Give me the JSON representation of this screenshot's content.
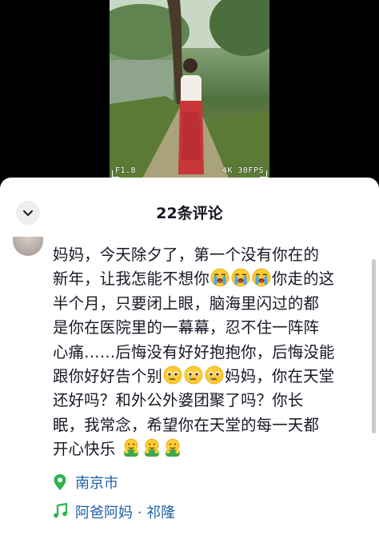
{
  "video": {
    "aperture": "F1.8",
    "quality": "4K 30FPS"
  },
  "comments_sheet": {
    "title": "22条评论"
  },
  "comment": {
    "lines": [
      {
        "text": "妈妈，今天除夕了，第一个没有你在的"
      },
      {
        "pre": "新年，让我怎能不想你",
        "emoji": "loudly-crying-face",
        "count": 3,
        "post": "你走的这"
      },
      {
        "text": "半个月，只要闭上眼，脑海里闪过的都"
      },
      {
        "text": "是你在医院里的一幕幕，忍不住一阵阵"
      },
      {
        "text": "心痛……后悔没有好好抱抱你，后悔没能"
      },
      {
        "pre": "跟你好好告个别",
        "emoji": "crying-face",
        "count": 3,
        "post": "妈妈，你在天堂"
      },
      {
        "text": "还好吗？和外公外婆团聚了吗？你长"
      },
      {
        "text": "眠，我常念，希望你在天堂的每一天都"
      },
      {
        "pre": "开心快乐 ",
        "emoji": "hugging-face",
        "count": 3,
        "post": ""
      }
    ],
    "location": "南京市",
    "music": "阿爸阿妈 · 祁隆"
  },
  "colors": {
    "link": "#1f5fa8",
    "location_icon": "#2db34a",
    "music_icon": "#2db34a",
    "text": "#161823"
  }
}
